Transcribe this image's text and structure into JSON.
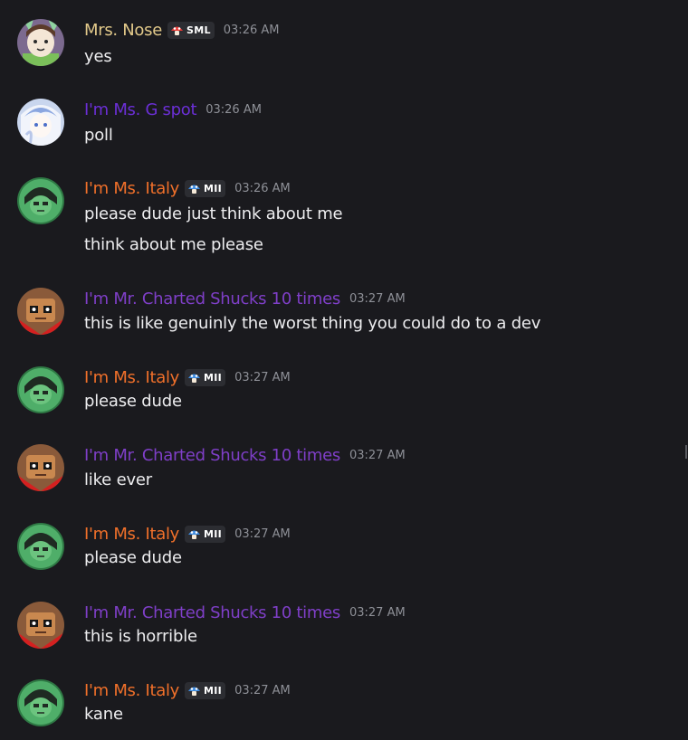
{
  "colors": {
    "background": "#1a1a1e",
    "author_nose": "#e2c98a",
    "author_gspot": "#6b2fd6",
    "author_italy": "#f0702a",
    "author_shucks": "#7f3fc8",
    "timestamp": "#8e9097",
    "message_text": "#ededef"
  },
  "messages": [
    {
      "author": "Mrs. Nose",
      "tag": "SML",
      "tag_icon": "red-mushroom-icon",
      "time": "03:26 AM",
      "lines": [
        "yes"
      ]
    },
    {
      "author": "I'm Ms. G spot",
      "tag": "",
      "time": "03:26 AM",
      "lines": [
        "poll"
      ]
    },
    {
      "author": "I'm Ms. Italy",
      "tag": "MII",
      "tag_icon": "blue-mushroom-icon",
      "time": "03:26 AM",
      "lines": [
        "please dude just think about me",
        "think about me please"
      ]
    },
    {
      "author": "I'm Mr. Charted Shucks 10 times",
      "tag": "",
      "time": "03:27 AM",
      "lines": [
        "this is like genuinly the worst thing you could do to a dev"
      ]
    },
    {
      "author": "I'm Ms. Italy",
      "tag": "MII",
      "tag_icon": "blue-mushroom-icon",
      "time": "03:27 AM",
      "lines": [
        "please dude"
      ]
    },
    {
      "author": "I'm Mr. Charted Shucks 10 times",
      "tag": "",
      "time": "03:27 AM",
      "lines": [
        "like ever"
      ]
    },
    {
      "author": "I'm Ms. Italy",
      "tag": "MII",
      "tag_icon": "blue-mushroom-icon",
      "time": "03:27 AM",
      "lines": [
        "please dude"
      ]
    },
    {
      "author": "I'm Mr. Charted Shucks 10 times",
      "tag": "",
      "time": "03:27 AM",
      "lines": [
        "this is horrible"
      ]
    },
    {
      "author": "I'm Ms. Italy",
      "tag": "MII",
      "tag_icon": "blue-mushroom-icon",
      "time": "03:27 AM",
      "lines": [
        "kane"
      ]
    }
  ]
}
